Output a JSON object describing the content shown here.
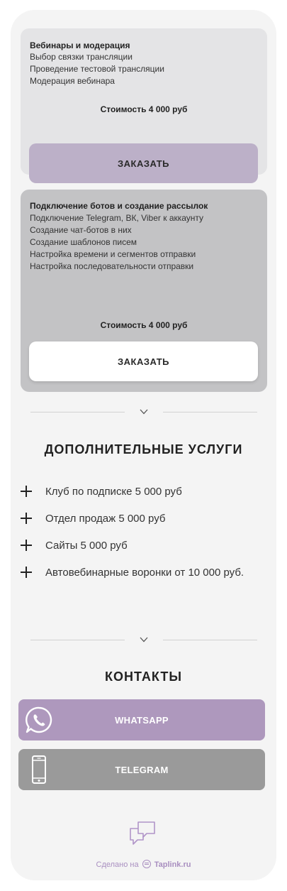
{
  "cards": [
    {
      "title": "Вебинары и модерация",
      "lines": [
        "Выбор связки трансляции",
        "Проведение тестовой трансляции",
        "Модерация вебинара"
      ],
      "price": "Стоимость 4 000 руб",
      "button": "ЗАКАЗАТЬ"
    },
    {
      "title": "Подключение ботов и создание рассылок",
      "lines": [
        "Подключение Telegram, ВК, Viber к аккаунту",
        "Создание чат-ботов в них",
        "Создание шаблонов писем",
        "Настройка времени и сегментов отправки",
        "Настройка последовательности отправки"
      ],
      "price": "Стоимость 4 000 руб",
      "button": "ЗАКАЗАТЬ"
    }
  ],
  "extras": {
    "title": "ДОПОЛНИТЕЛЬНЫЕ УСЛУГИ",
    "items": [
      "Клуб по подписке 5 000 руб",
      "Отдел продаж 5 000 руб",
      "Сайты 5 000 руб",
      "Автовебинарные воронки от 10 000 руб."
    ]
  },
  "contacts": {
    "title": "КОНТАКТЫ",
    "whatsapp": "WHATSAPP",
    "telegram": "TELEGRAM"
  },
  "footer": {
    "prefix": "Сделано на",
    "brand": "Taplink.ru"
  },
  "colors": {
    "accent": "#ae98bd",
    "card1": "#e4e4e6",
    "card2": "#c3c3c5",
    "gray_button": "#9a9a9a",
    "footer_text": "#a98fc0"
  },
  "icons": {
    "divider": "chevron-down-icon",
    "extras_bullet": "plus-icon",
    "whatsapp": "whatsapp-icon",
    "telegram": "phone-icon",
    "chat": "chat-bubbles-icon",
    "footer": "taplink-logo-icon"
  }
}
